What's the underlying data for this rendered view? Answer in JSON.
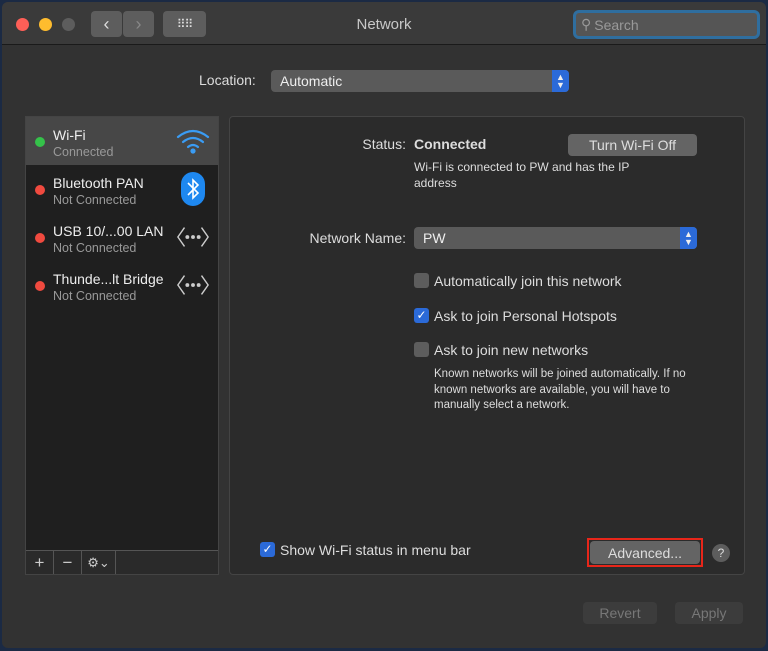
{
  "window": {
    "title": "Network",
    "search_placeholder": "Search"
  },
  "location": {
    "label": "Location:",
    "value": "Automatic"
  },
  "services": [
    {
      "name": "Wi-Fi",
      "status": "Connected",
      "color": "#35c24a",
      "icon": "wifi-icon"
    },
    {
      "name": "Bluetooth PAN",
      "status": "Not Connected",
      "color": "#f04a3f",
      "icon": "bluetooth-icon"
    },
    {
      "name": "USB 10/...00 LAN",
      "status": "Not Connected",
      "color": "#f04a3f",
      "icon": "ethernet-icon"
    },
    {
      "name": "Thunde...lt Bridge",
      "status": "Not Connected",
      "color": "#f04a3f",
      "icon": "ethernet-icon"
    }
  ],
  "sidebar_bar": {
    "add": "+",
    "remove": "−",
    "gear": "⚙⌄"
  },
  "detail": {
    "status_label": "Status:",
    "status_value": "Connected",
    "turn_off": "Turn Wi-Fi Off",
    "status_desc": "Wi-Fi is connected to PW and has the IP address",
    "network_name_label": "Network Name:",
    "network_name": "PW",
    "auto_join": {
      "label": "Automatically join this network",
      "checked": false
    },
    "hotspots": {
      "label": "Ask to join Personal Hotspots",
      "checked": true
    },
    "new_networks": {
      "label": "Ask to join new networks",
      "checked": false
    },
    "note": "Known networks will be joined automatically. If no known networks are available, you will have to manually select a network.",
    "show_status": {
      "label": "Show Wi-Fi status in menu bar",
      "checked": true
    },
    "advanced": "Advanced...",
    "help": "?"
  },
  "footer": {
    "revert": "Revert",
    "apply": "Apply"
  }
}
